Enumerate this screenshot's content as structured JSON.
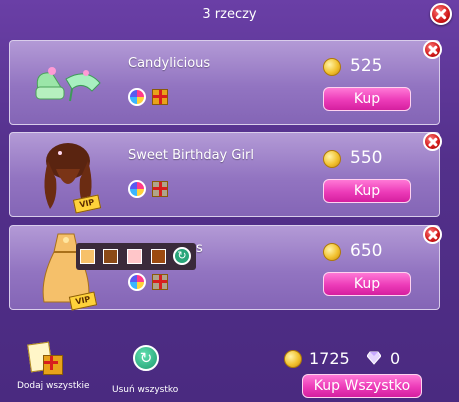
{
  "header": {
    "title": "3 rzeczy"
  },
  "items": [
    {
      "name": "Candylicious",
      "price": "525",
      "buy_label": "Kup"
    },
    {
      "name": "Sweet Birthday Girl",
      "price": "550",
      "buy_label": "Kup"
    },
    {
      "name": "s",
      "price": "650",
      "buy_label": "Kup"
    }
  ],
  "badges": {
    "vip": "VIP"
  },
  "footer": {
    "add_all_label": "Dodaj wszystkie",
    "remove_all_label": "Usuń wszystko",
    "coins": "1725",
    "diamonds": "0",
    "buy_all_label": "Kup Wszystko"
  },
  "colors": {
    "accent": "#ec3bb8",
    "background": "#53308b",
    "row": "#9274c1",
    "close": "#d01818",
    "swatches": [
      "#f7c16a",
      "#8b4a16",
      "#ffc6c9",
      "#9c4a10"
    ]
  },
  "icons": [
    "close-icon",
    "coin-icon",
    "color-wheel-icon",
    "gift-icon",
    "vip-badge-icon",
    "diamond-icon",
    "refresh-icon"
  ]
}
